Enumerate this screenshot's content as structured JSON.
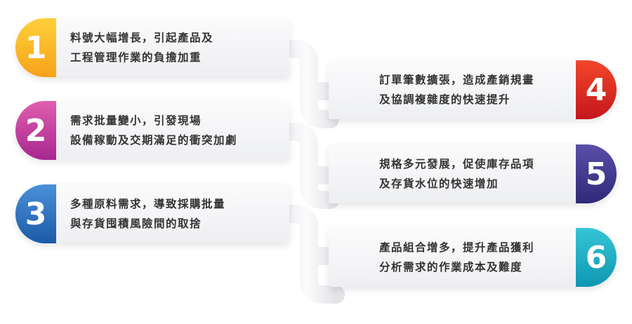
{
  "items": [
    {
      "number": "1",
      "line1": "料號大幅增長，引起產品及",
      "line2": "工程管理作業的負擔加重",
      "color_top": "#ffd03a",
      "color_bottom": "#f6a21a"
    },
    {
      "number": "2",
      "line1": "需求批量變小，引發現場",
      "line2": "設備稼動及交期滿足的衝突加劇",
      "color_top": "#e05fae",
      "color_bottom": "#a8278f"
    },
    {
      "number": "3",
      "line1": "多種原料需求，導致採購批量",
      "line2": "與存貨囤積風險間的取捨",
      "color_top": "#4a90d9",
      "color_bottom": "#1c5aa8"
    },
    {
      "number": "4",
      "line1": "訂單筆數擴張，造成產銷規畫",
      "line2": "及協調複雜度的快速提升",
      "color_top": "#f2472a",
      "color_bottom": "#c4161c"
    },
    {
      "number": "5",
      "line1": "規格多元發展，促使庫存品項",
      "line2": "及存貨水位的快速增加",
      "color_top": "#5b4ea8",
      "color_bottom": "#2e2a78"
    },
    {
      "number": "6",
      "line1": "產品組合增多，提升產品獲利",
      "line2": "分析需求的作業成本及難度",
      "color_top": "#35c5d6",
      "color_bottom": "#0f97b2"
    }
  ]
}
